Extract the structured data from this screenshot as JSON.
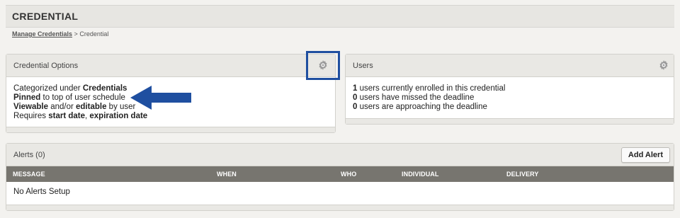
{
  "page": {
    "title": "CREDENTIAL"
  },
  "breadcrumb": {
    "link": "Manage Credentials",
    "separator": ">",
    "current": "Credential"
  },
  "credential_options": {
    "title": "Credential Options",
    "line1": {
      "prefix": "Categorized under ",
      "value": "Credentials"
    },
    "line2": {
      "value": "Pinned",
      "suffix": " to top of user schedule"
    },
    "line3": {
      "value1": "Viewable",
      "mid": " and/or ",
      "value2": "editable",
      "suffix": " by user"
    },
    "line4": {
      "prefix": "Requires ",
      "value1": "start date",
      "sep": ", ",
      "value2": "expiration date"
    },
    "gear_icon": "gear-icon"
  },
  "users": {
    "title": "Users",
    "lines": [
      {
        "count": "1",
        "text": " users currently enrolled in this credential"
      },
      {
        "count": "0",
        "text": " users have missed the deadline"
      },
      {
        "count": "0",
        "text": " users are approaching the deadline"
      }
    ],
    "gear_icon": "gear-icon"
  },
  "alerts": {
    "title": "Alerts (0)",
    "add_button": "Add Alert",
    "columns": [
      "MESSAGE",
      "WHEN",
      "WHO",
      "INDIVIDUAL",
      "DELIVERY"
    ],
    "empty_text": "No Alerts Setup"
  },
  "annotations": {
    "highlight_color": "#1f4fa0",
    "arrow_color": "#1f4fa0"
  }
}
